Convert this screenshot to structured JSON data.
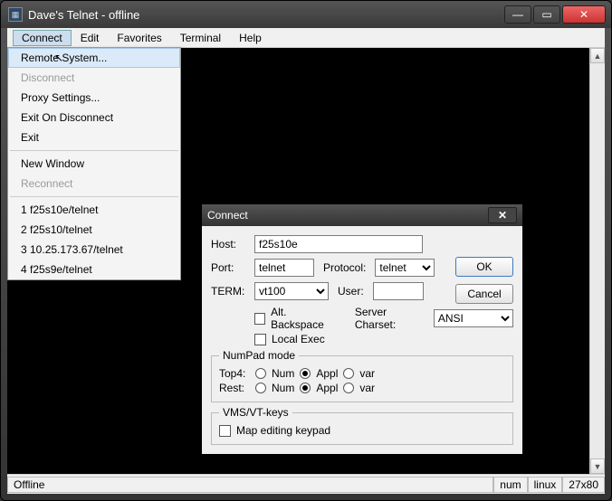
{
  "window": {
    "title": "Dave's Telnet - offline",
    "min": "—",
    "max": "▭",
    "close": "✕"
  },
  "menubar": [
    "Connect",
    "Edit",
    "Favorites",
    "Terminal",
    "Help"
  ],
  "dropdown": {
    "remote": "Remote System...",
    "disconnect": "Disconnect",
    "proxy": "Proxy Settings...",
    "exitdc": "Exit On Disconnect",
    "exit": "Exit",
    "newwin": "New Window",
    "reconnect": "Reconnect",
    "recent": [
      "1 f25s10e/telnet",
      "2 f25s10/telnet",
      "3 10.25.173.67/telnet",
      "4 f25s9e/telnet"
    ]
  },
  "dialog": {
    "title": "Connect",
    "close": "✕",
    "host_lbl": "Host:",
    "host_val": "f25s10e",
    "port_lbl": "Port:",
    "port_val": "telnet",
    "protocol_lbl": "Protocol:",
    "protocol_val": "telnet",
    "term_lbl": "TERM:",
    "term_val": "vt100",
    "user_lbl": "User:",
    "user_val": "",
    "alt_bs": "Alt. Backspace",
    "local_exec": "Local Exec",
    "charset_lbl": "Server Charset:",
    "charset_val": "ANSI",
    "numpad_legend": "NumPad mode",
    "np_top4": "Top4:",
    "np_rest": "Rest:",
    "np_num": "Num",
    "np_appl": "Appl",
    "np_var": "var",
    "vms_legend": "VMS/VT-keys",
    "vms_map": "Map editing keypad",
    "ok": "OK",
    "cancel": "Cancel"
  },
  "statusbar": {
    "status": "Offline",
    "num": "num",
    "term": "linux",
    "size": "27x80"
  }
}
